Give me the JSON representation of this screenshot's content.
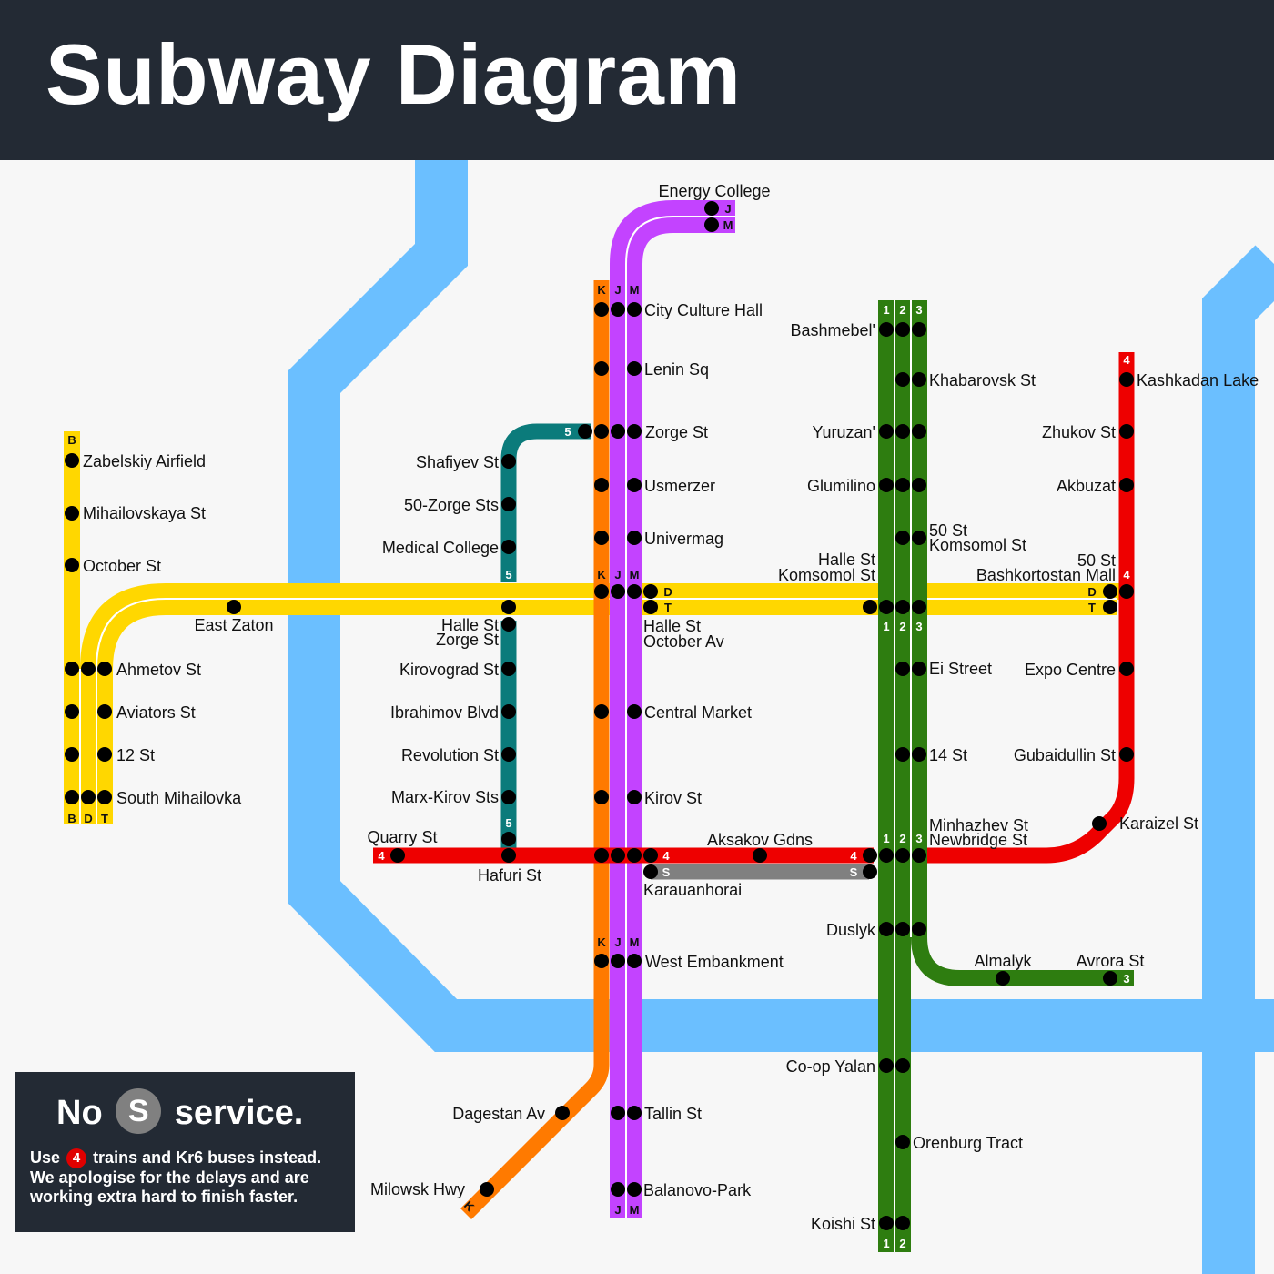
{
  "title": "Subway Diagram",
  "notice": {
    "no": "No",
    "badge": "S",
    "service": "service.",
    "line1_a": "Use",
    "line1_badge": "4",
    "line1_b": "trains and Kr6 buses instead.",
    "line2": "We apologise for the delays and are",
    "line3": "working extra hard to finish faster."
  },
  "colors": {
    "river": "#6bbfff",
    "line_1_2_3": "#2e7d10",
    "line_4": "#ee0000",
    "line_5": "#0b7b7b",
    "line_K": "#ff7a00",
    "line_J_M": "#c343ff",
    "line_B_D_T": "#ffd700",
    "line_S": "#808080",
    "header_bg": "#232a34"
  },
  "route_labels": {
    "B": "B",
    "D": "D",
    "T": "T",
    "K": "K",
    "J": "J",
    "M": "M",
    "one": "1",
    "two": "2",
    "three": "3",
    "four": "4",
    "five": "5",
    "S": "S"
  },
  "stations": {
    "energy_college": "Energy College",
    "city_culture_hall": "City Culture Hall",
    "lenin_sq": "Lenin Sq",
    "zorge_st": "Zorge St",
    "usmerzer": "Usmerzer",
    "univermag": "Univermag",
    "central_market": "Central Market",
    "kirov_st": "Kirov St",
    "west_embankment": "West Embankment",
    "tallin_st": "Tallin St",
    "balanovo_park": "Balanovo-Park",
    "dagestan_av": "Dagestan Av",
    "milowsk_hwy": "Milowsk Hwy",
    "zabelskiy_airfield": "Zabelskiy Airfield",
    "mihailovskaya_st": "Mihailovskaya St",
    "october_st": "October St",
    "ahmetov_st": "Ahmetov St",
    "aviators_st": "Aviators St",
    "twelve_st": "12 St",
    "south_mihailovka": "South Mihailovka",
    "east_zaton": "East Zaton",
    "shafiyev_st": "Shafiyev St",
    "fifty_zorge_sts": "50-Zorge Sts",
    "medical_college": "Medical College",
    "halle_zorge_1": "Halle St",
    "halle_zorge_2": "Zorge St",
    "kirovograd_st": "Kirovograd St",
    "ibrahimov_blvd": "Ibrahimov Blvd",
    "revolution_st": "Revolution St",
    "marx_kirov_sts": "Marx-Kirov Sts",
    "quarry_st": "Quarry St",
    "hafuri_st": "Hafuri St",
    "halle_october_1": "Halle St",
    "halle_october_2": "October Av",
    "aksakov_gdns": "Aksakov Gdns",
    "karauanhorai": "Karauanhorai",
    "halle_komsomol_1": "Halle St",
    "halle_komsomol_2": "Komsomol St",
    "bashmebel": "Bashmebel'",
    "khabarovsk_st": "Khabarovsk St",
    "yuruzan": "Yuruzan'",
    "glumilino": "Glumilino",
    "fifty_komsomol_1": "50 St",
    "fifty_komsomol_2": "Komsomol St",
    "ei_street": "Ei Street",
    "fourteen_st": "14 St",
    "minhazhev_1": "Minhazhev St",
    "minhazhev_2": "Newbridge St",
    "duslyk": "Duslyk",
    "almalyk": "Almalyk",
    "avrora_st": "Avrora St",
    "coop_yalan": "Co-op Yalan",
    "orenburg_tract": "Orenburg Tract",
    "koishi_st": "Koishi St",
    "kashkadan_lake": "Kashkadan Lake",
    "zhukov_st": "Zhukov St",
    "akbuzat": "Akbuzat",
    "fifty_bashkortostan_1": "50 St",
    "fifty_bashkortostan_2": "Bashkortostan Mall",
    "expo_centre": "Expo Centre",
    "gubaidullin_st": "Gubaidullin St",
    "karaizel_st": "Karaizel St"
  }
}
